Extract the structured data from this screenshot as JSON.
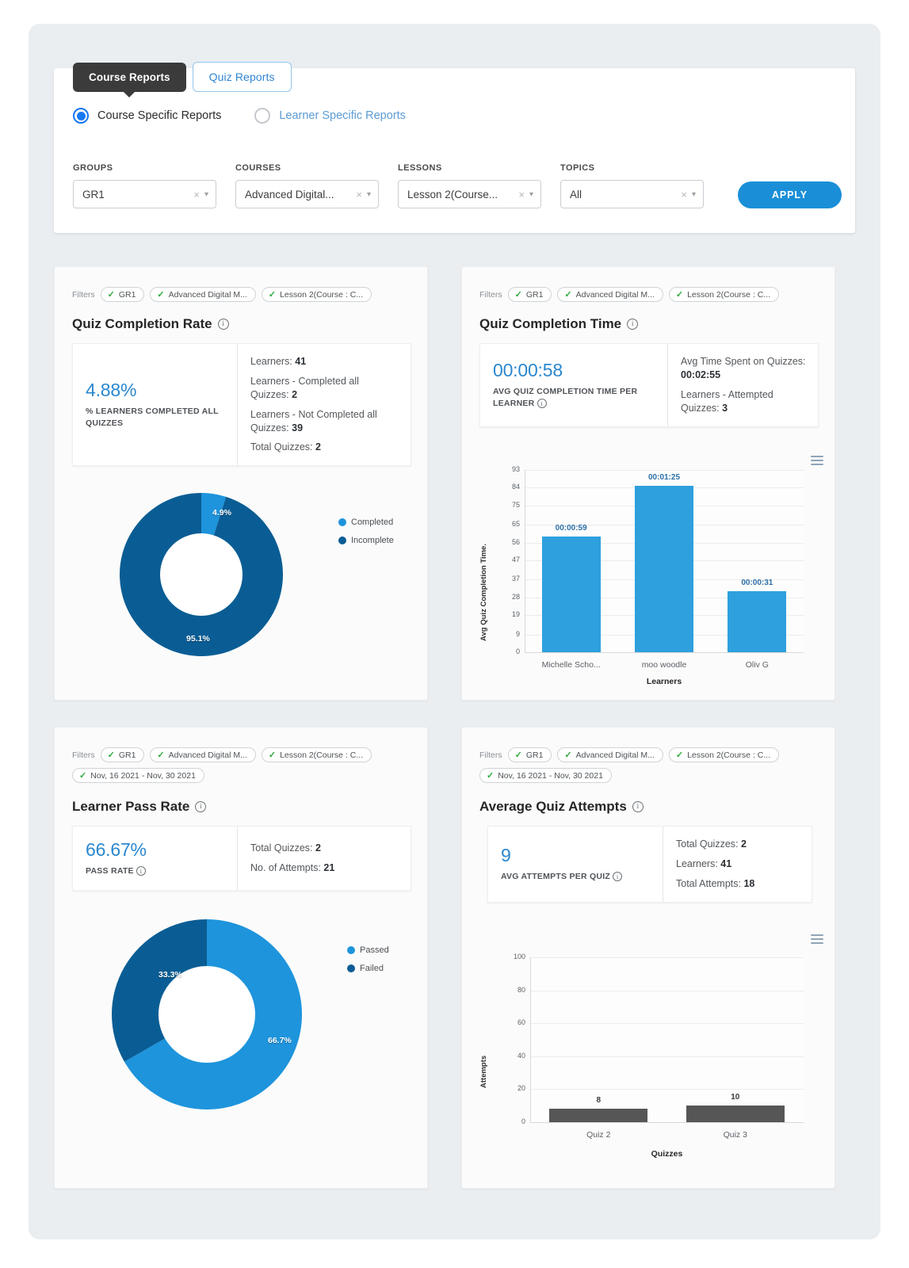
{
  "tabs": [
    {
      "label": "Course Reports",
      "active": true
    },
    {
      "label": "Quiz Reports",
      "active": false
    }
  ],
  "report_scope": {
    "options": [
      {
        "label": "Course Specific Reports",
        "selected": true
      },
      {
        "label": "Learner Specific Reports",
        "selected": false
      }
    ]
  },
  "filters": {
    "fields": [
      {
        "label": "GROUPS",
        "value": "GR1"
      },
      {
        "label": "COURSES",
        "value": "Advanced Digital..."
      },
      {
        "label": "LESSONS",
        "value": "Lesson 2(Course..."
      },
      {
        "label": "TOPICS",
        "value": "All"
      }
    ],
    "apply_label": "APPLY",
    "clear_icon": "×",
    "caret_icon": "⌵"
  },
  "common": {
    "filters_label": "Filters",
    "check_icon": "✓",
    "info_icon": "i",
    "chips": [
      "GR1",
      "Advanced Digital M...",
      "Lesson 2(Course : C..."
    ],
    "date_chip": "Nov, 16 2021 - Nov, 30 2021"
  },
  "colors": {
    "accent_blue": "#1a8fd8",
    "light_blue": "#1e94dc",
    "dark_blue": "#0a5d94",
    "bar_blue": "#2ea0de",
    "bar_gray": "#565656",
    "tab_dark": "#3b3b3b",
    "radio_blue": "#1877f2",
    "check_green": "#2eab3a"
  },
  "cards": {
    "quiz_completion_rate": {
      "title": "Quiz Completion Rate",
      "big_value": "4.88%",
      "big_caption": "% LEARNERS COMPLETED ALL QUIZZES",
      "stats": [
        {
          "label": "Learners:",
          "value": "41"
        },
        {
          "label": "Learners - Completed all Quizzes:",
          "value": "2"
        },
        {
          "label": "Learners - Not Completed all Quizzes:",
          "value": "39"
        },
        {
          "label": "Total Quizzes:",
          "value": "2"
        }
      ]
    },
    "quiz_completion_time": {
      "title": "Quiz Completion Time",
      "big_value": "00:00:58",
      "big_caption": "AVG QUIZ COMPLETION TIME PER LEARNER",
      "stats": [
        {
          "label": "Avg Time Spent on Quizzes:",
          "value": "00:02:55"
        },
        {
          "label": "Learners - Attempted Quizzes:",
          "value": "3"
        }
      ]
    },
    "learner_pass_rate": {
      "title": "Learner Pass Rate",
      "big_value": "66.67%",
      "big_caption": "PASS RATE",
      "stats": [
        {
          "label": "Total Quizzes:",
          "value": "2"
        },
        {
          "label": "No. of Attempts:",
          "value": "21"
        }
      ]
    },
    "average_quiz_attempts": {
      "title": "Average Quiz Attempts",
      "big_value": "9",
      "big_caption": "AVG ATTEMPTS PER QUIZ",
      "stats": [
        {
          "label": "Total Quizzes:",
          "value": "2"
        },
        {
          "label": "Learners:",
          "value": "41"
        },
        {
          "label": "Total Attempts:",
          "value": "18"
        }
      ]
    }
  },
  "chart_data": [
    {
      "id": "quiz_completion_rate_donut",
      "type": "pie",
      "title": "Quiz Completion Rate",
      "labels": [
        "Completed",
        "Incomplete"
      ],
      "values": [
        4.9,
        95.1
      ],
      "data_labels": [
        "4.9%",
        "95.1%"
      ],
      "colors": [
        "#1e94dc",
        "#0a5d94"
      ],
      "legend_position": "right",
      "donut": true
    },
    {
      "id": "quiz_completion_time_bar",
      "type": "bar",
      "title": "",
      "categories": [
        "Michelle Scho...",
        "moo woodle",
        "Oliv G"
      ],
      "values": [
        59,
        85,
        31
      ],
      "data_labels": [
        "00:00:59",
        "00:01:25",
        "00:00:31"
      ],
      "xlabel": "Learners",
      "ylabel": "Avg Quiz Completion Time.",
      "yticks": [
        0,
        9,
        19,
        28,
        37,
        47,
        56,
        65,
        75,
        84,
        93
      ],
      "ylim": [
        0,
        93
      ],
      "grid": true,
      "color": "#2ea0de",
      "menu_icon": "hamburger-menu-icon"
    },
    {
      "id": "learner_pass_rate_donut",
      "type": "pie",
      "title": "Learner Pass Rate",
      "labels": [
        "Passed",
        "Failed"
      ],
      "values": [
        66.7,
        33.3
      ],
      "data_labels": [
        "66.7%",
        "33.3%"
      ],
      "colors": [
        "#1e94dc",
        "#0a5d94"
      ],
      "legend_position": "right",
      "donut": true
    },
    {
      "id": "average_quiz_attempts_bar",
      "type": "bar",
      "title": "",
      "categories": [
        "Quiz 2",
        "Quiz 3"
      ],
      "values": [
        8,
        10
      ],
      "data_labels": [
        "8",
        "10"
      ],
      "xlabel": "Quizzes",
      "ylabel": "Attempts",
      "yticks": [
        0,
        20,
        40,
        60,
        80,
        100
      ],
      "ylim": [
        0,
        100
      ],
      "grid": true,
      "color": "#565656",
      "menu_icon": "hamburger-menu-icon"
    }
  ]
}
